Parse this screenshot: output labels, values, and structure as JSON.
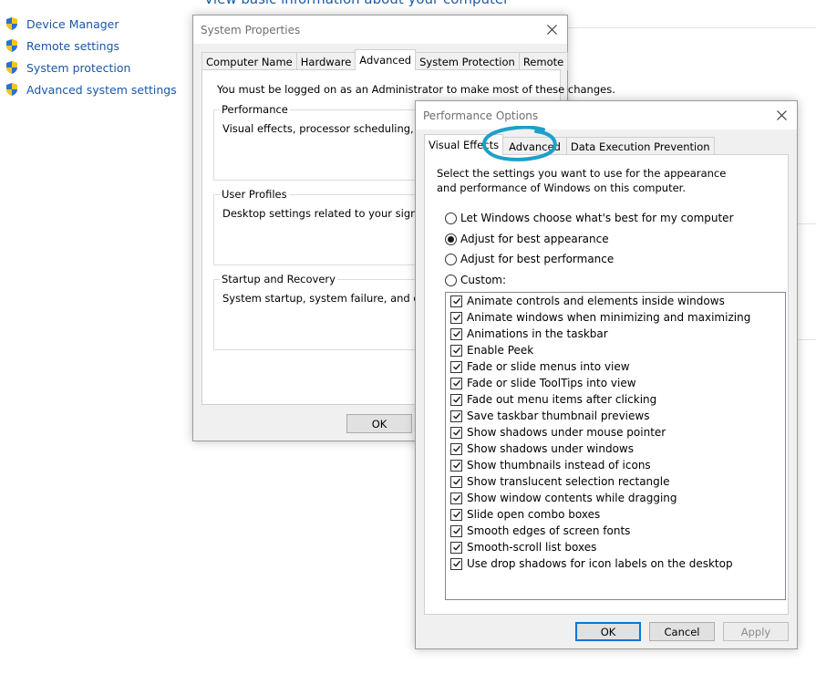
{
  "background": {
    "top_link": "View basic information about your computer",
    "nav": [
      {
        "label": "Device Manager",
        "icon": "shield-icon"
      },
      {
        "label": "Remote settings",
        "icon": "shield-icon"
      },
      {
        "label": "System protection",
        "icon": "shield-icon"
      },
      {
        "label": "Advanced system settings",
        "icon": "shield-icon"
      }
    ]
  },
  "system_properties": {
    "title": "System Properties",
    "tabs": [
      "Computer Name",
      "Hardware",
      "Advanced",
      "System Protection",
      "Remote"
    ],
    "active_tab": "Advanced",
    "admin_note": "You must be logged on as an Administrator to make most of these changes.",
    "groups": [
      {
        "title": "Performance",
        "desc": "Visual effects, processor scheduling, memory"
      },
      {
        "title": "User Profiles",
        "desc": "Desktop settings related to your sign-in"
      },
      {
        "title": "Startup and Recovery",
        "desc": "System startup, system failure, and debugging"
      }
    ],
    "ok_label": "OK"
  },
  "performance_options": {
    "title": "Performance Options",
    "tabs": [
      "Visual Effects",
      "Advanced",
      "Data Execution Prevention"
    ],
    "active_tab": "Visual Effects",
    "intro": "Select the settings you want to use for the appearance and performance of Windows on this computer.",
    "options": [
      {
        "label": "Let Windows choose what's best for my computer",
        "selected": false
      },
      {
        "label": "Adjust for best appearance",
        "selected": true
      },
      {
        "label": "Adjust for best performance",
        "selected": false
      },
      {
        "label": "Custom:",
        "selected": false
      }
    ],
    "effects": [
      {
        "label": "Animate controls and elements inside windows",
        "checked": true
      },
      {
        "label": "Animate windows when minimizing and maximizing",
        "checked": true
      },
      {
        "label": "Animations in the taskbar",
        "checked": true
      },
      {
        "label": "Enable Peek",
        "checked": true
      },
      {
        "label": "Fade or slide menus into view",
        "checked": true
      },
      {
        "label": "Fade or slide ToolTips into view",
        "checked": true
      },
      {
        "label": "Fade out menu items after clicking",
        "checked": true
      },
      {
        "label": "Save taskbar thumbnail previews",
        "checked": true
      },
      {
        "label": "Show shadows under mouse pointer",
        "checked": true
      },
      {
        "label": "Show shadows under windows",
        "checked": true
      },
      {
        "label": "Show thumbnails instead of icons",
        "checked": true
      },
      {
        "label": "Show translucent selection rectangle",
        "checked": true
      },
      {
        "label": "Show window contents while dragging",
        "checked": true
      },
      {
        "label": "Slide open combo boxes",
        "checked": true
      },
      {
        "label": "Smooth edges of screen fonts",
        "checked": true
      },
      {
        "label": "Smooth-scroll list boxes",
        "checked": true
      },
      {
        "label": "Use drop shadows for icon labels on the desktop",
        "checked": true
      }
    ],
    "buttons": {
      "ok": "OK",
      "cancel": "Cancel",
      "apply": "Apply"
    },
    "annotation_color": "#1ea0c8"
  }
}
